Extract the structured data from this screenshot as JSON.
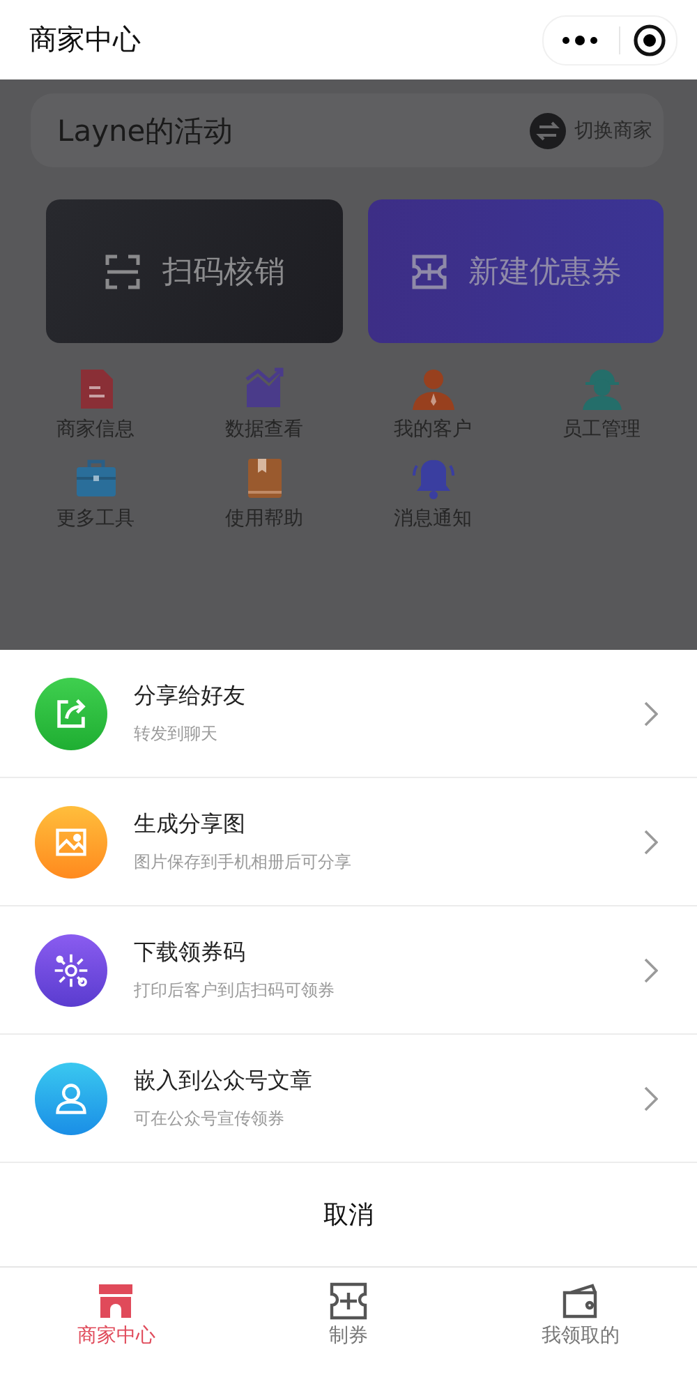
{
  "header": {
    "title": "商家中心"
  },
  "activity": {
    "title": "Layne的活动",
    "switch_label": "切换商家"
  },
  "actions": [
    {
      "label": "扫码核销",
      "kind": "scan"
    },
    {
      "label": "新建优惠券",
      "kind": "coupon"
    }
  ],
  "tools": [
    {
      "label": "商家信息",
      "kind": "doc"
    },
    {
      "label": "数据查看",
      "kind": "chart"
    },
    {
      "label": "我的客户",
      "kind": "customer"
    },
    {
      "label": "员工管理",
      "kind": "staff"
    },
    {
      "label": "更多工具",
      "kind": "toolbox"
    },
    {
      "label": "使用帮助",
      "kind": "book"
    },
    {
      "label": "消息通知",
      "kind": "bell"
    }
  ],
  "share_sheet": {
    "options": [
      {
        "title": "分享给好友",
        "subtitle": "转发到聊天",
        "kind": "share"
      },
      {
        "title": "生成分享图",
        "subtitle": "图片保存到手机相册后可分享",
        "kind": "image"
      },
      {
        "title": "下载领券码",
        "subtitle": "打印后客户到店扫码可领券",
        "kind": "code"
      },
      {
        "title": "嵌入到公众号文章",
        "subtitle": "可在公众号宣传领券",
        "kind": "article"
      }
    ],
    "cancel": "取消"
  },
  "tab_bar": [
    {
      "label": "商家中心",
      "kind": "store",
      "selected": true
    },
    {
      "label": "制券",
      "kind": "coupon",
      "selected": false
    },
    {
      "label": "我领取的",
      "kind": "wallet",
      "selected": false
    }
  ]
}
